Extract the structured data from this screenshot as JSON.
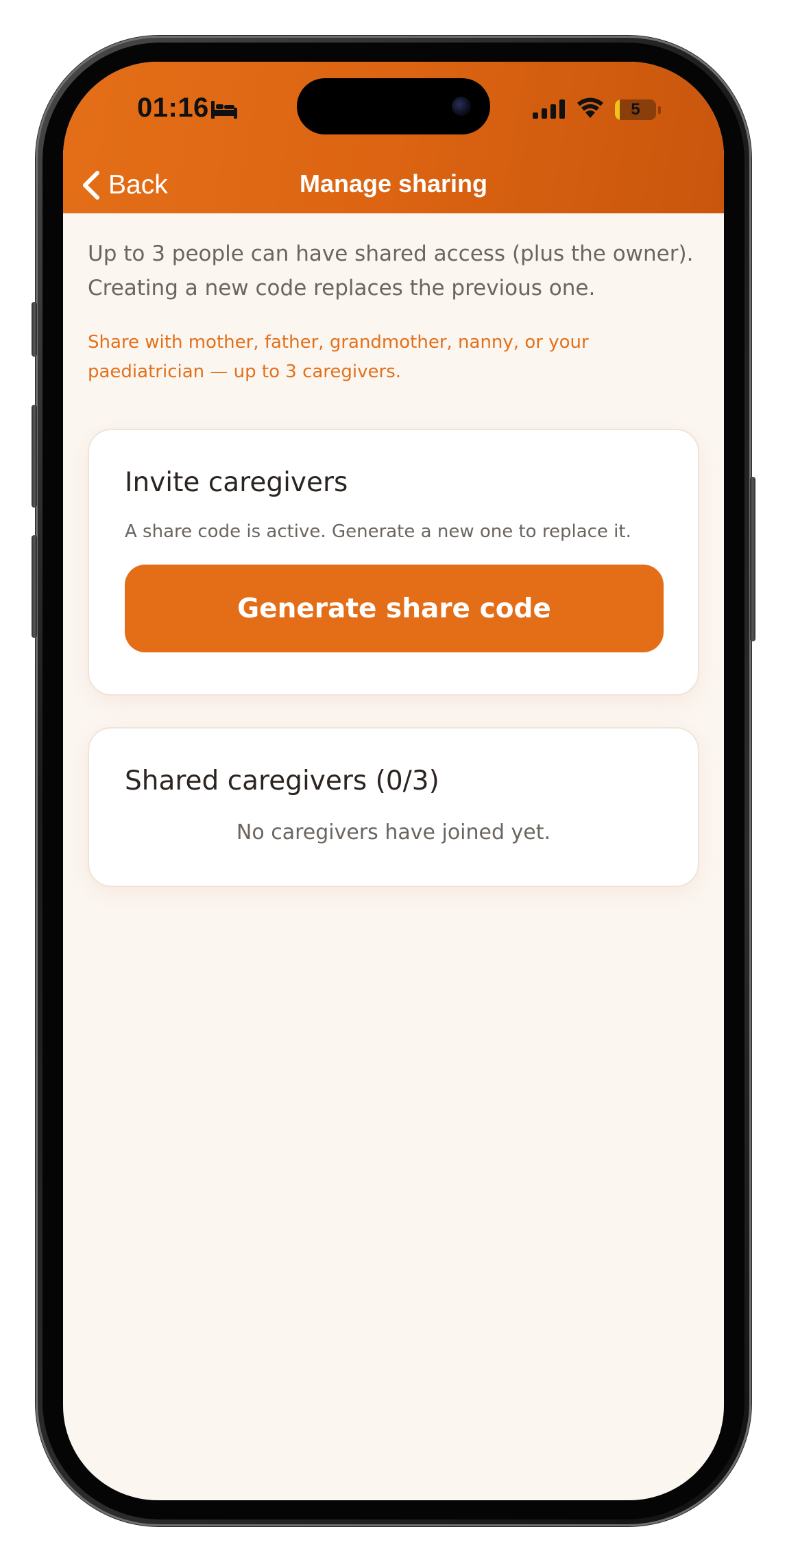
{
  "status_bar": {
    "time": "01:16",
    "battery_level": "5",
    "battery_fraction": 0.05,
    "icons": [
      "bed-icon",
      "signal-icon",
      "wifi-icon",
      "battery-icon"
    ]
  },
  "nav": {
    "back_label": "Back",
    "title": "Manage sharing"
  },
  "intro": "Up to 3 people can have shared access (plus the owner). Creating a new code replaces the previous one.",
  "note": "Share with mother, father, grandmother, nanny, or your paediatrician — up to 3 caregivers.",
  "invite_card": {
    "title": "Invite caregivers",
    "subtitle": "A share code is active. Generate a new one to replace it.",
    "button_label": "Generate share code"
  },
  "shared_card": {
    "title": "Shared caregivers (0/3)",
    "empty_message": "No caregivers have joined yet."
  },
  "colors": {
    "accent": "#E46D18",
    "header_dark": "#C9560D",
    "background": "#FCF6F1",
    "note_text": "#E2701B"
  }
}
